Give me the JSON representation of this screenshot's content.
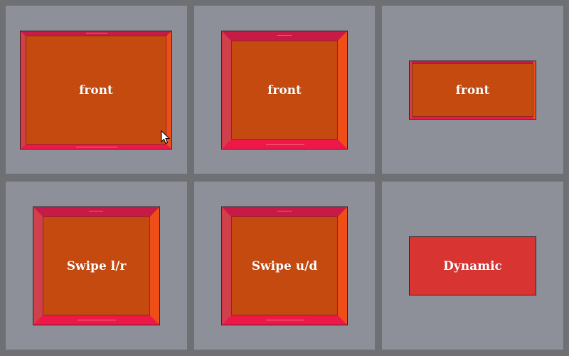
{
  "panels": [
    {
      "name": "panel-front-1",
      "label": "front"
    },
    {
      "name": "panel-front-2",
      "label": "front"
    },
    {
      "name": "panel-front-3",
      "label": "front"
    },
    {
      "name": "panel-swipe-lr",
      "label": "Swipe l/r"
    },
    {
      "name": "panel-swipe-ud",
      "label": "Swipe u/d"
    },
    {
      "name": "panel-dynamic",
      "label": "Dynamic"
    }
  ],
  "colors": {
    "background": "#6f7074",
    "cell": "#8e9099",
    "front_face": "#c44a10",
    "top_face": "#c81a46",
    "bottom_face": "#ee1848",
    "left_face": "#d0404a",
    "right_face": "#f04e18",
    "dynamic": "#d83432"
  },
  "icons": {
    "cursor": "mouse-pointer-icon"
  }
}
